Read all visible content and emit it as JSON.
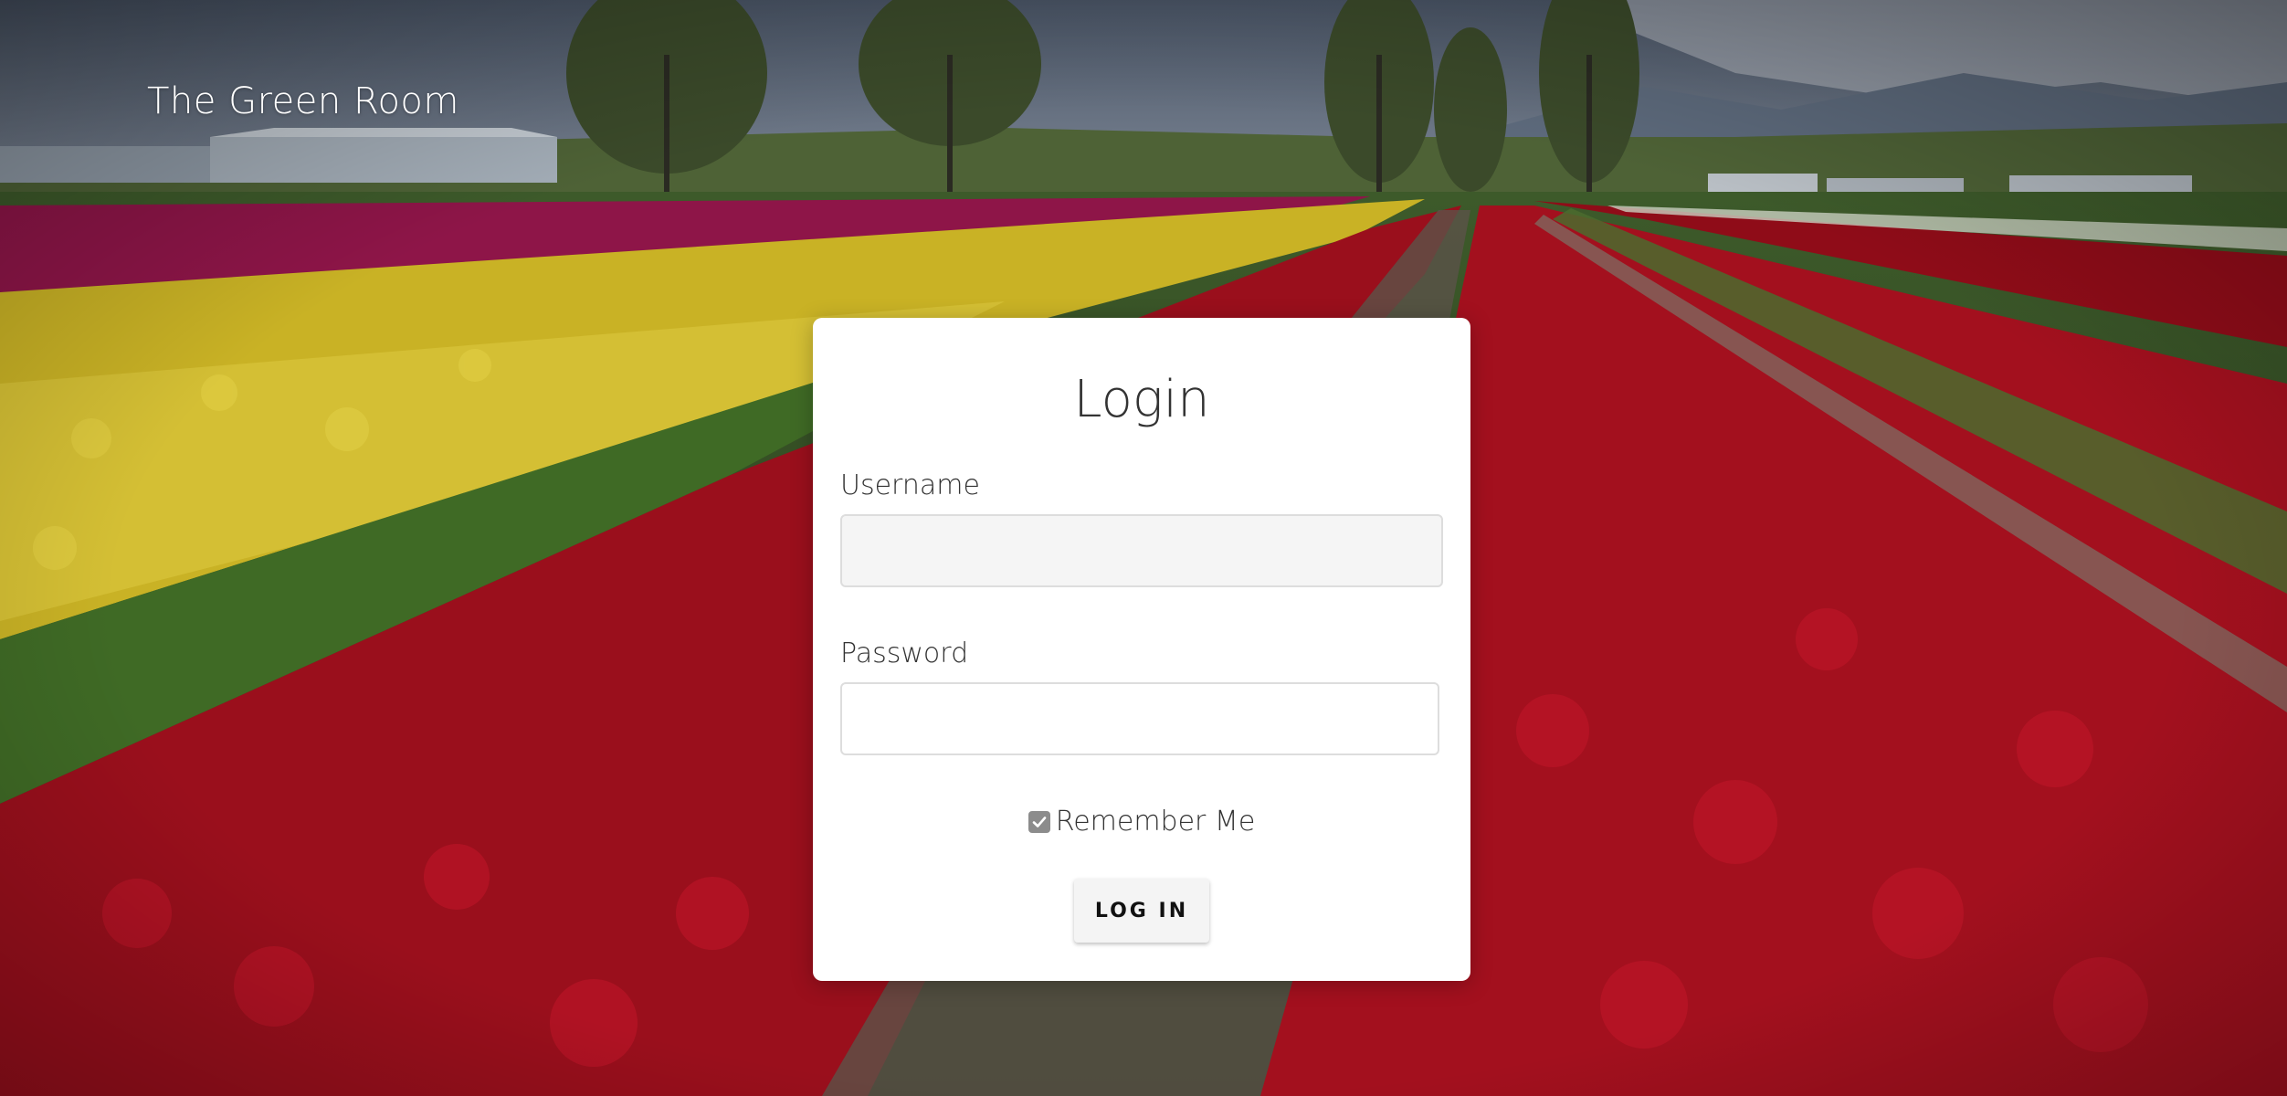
{
  "header": {
    "brand": "The Green Room"
  },
  "login_card": {
    "title": "Login",
    "username_label": "Username",
    "username_value": "",
    "password_label": "Password",
    "password_value": "",
    "remember_label": "Remember Me",
    "remember_checked": true,
    "submit_label": "LOG IN"
  },
  "colors": {
    "card_background": "#ffffff",
    "text_dark": "#333333",
    "input_filled_background": "#f5f5f5",
    "checkbox": "#8c8c8c",
    "button_background": "#f4f4f4"
  },
  "icons": {
    "checkbox_mark": "check-icon"
  }
}
